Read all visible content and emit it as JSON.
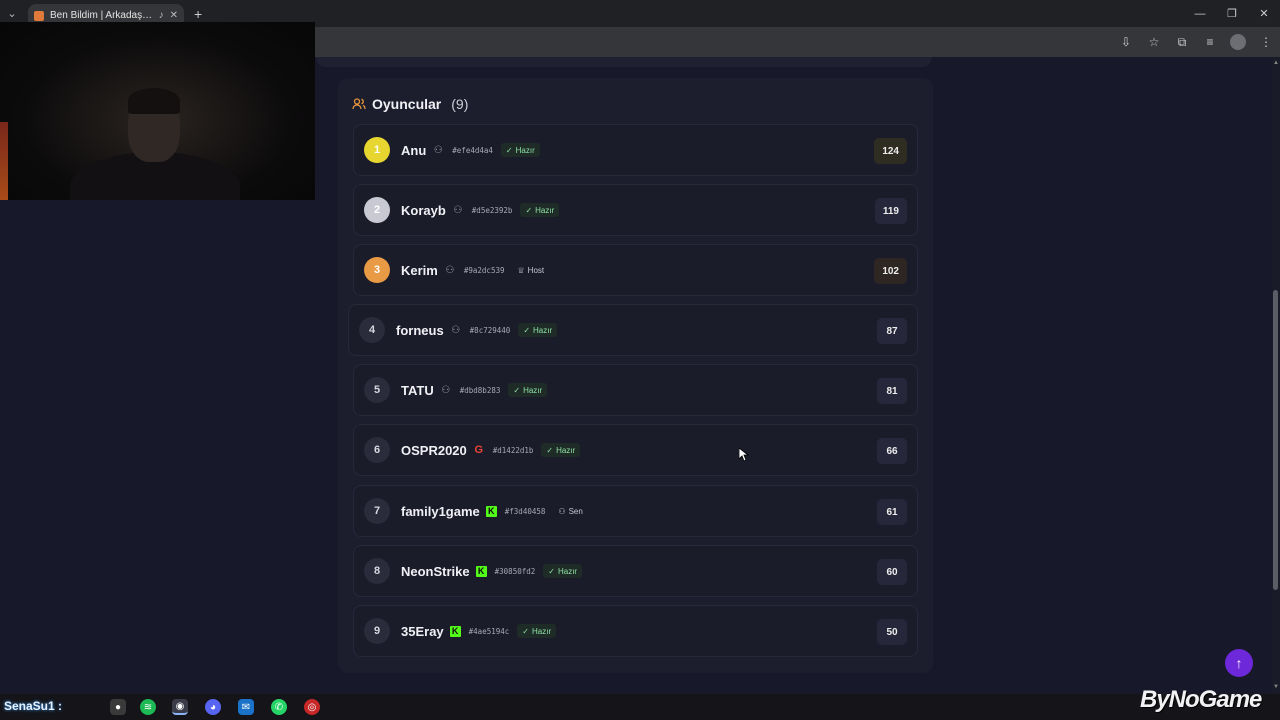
{
  "browser": {
    "tab_title": "Ben Bildim | Arkadaşlarınla",
    "new_tab": "+",
    "window_controls": [
      "—",
      "❐",
      "✕"
    ]
  },
  "panel": {
    "title": "Oyuncular",
    "count": "(9)"
  },
  "players": [
    {
      "rank": "1",
      "name": "Anu",
      "type": "user-icon",
      "id": "#efe4d4a4",
      "status": "Hazır",
      "status_type": "ready",
      "score": "124"
    },
    {
      "rank": "2",
      "name": "Korayb",
      "type": "user-icon",
      "id": "#d5e2392b",
      "status": "Hazır",
      "status_type": "ready",
      "score": "119"
    },
    {
      "rank": "3",
      "name": "Kerim",
      "type": "user-icon",
      "id": "#9a2dc539",
      "status": "Host",
      "status_type": "host",
      "score": "102"
    },
    {
      "rank": "4",
      "name": "forneus",
      "type": "user-icon",
      "id": "#8c729440",
      "status": "Hazır",
      "status_type": "ready",
      "score": "87"
    },
    {
      "rank": "5",
      "name": "TATU",
      "type": "user-icon",
      "id": "#dbd8b283",
      "status": "Hazır",
      "status_type": "ready",
      "score": "81"
    },
    {
      "rank": "6",
      "name": "OSPR2020",
      "type": "google-icon",
      "id": "#d1422d1b",
      "status": "Hazır",
      "status_type": "ready",
      "score": "66"
    },
    {
      "rank": "7",
      "name": "family1game",
      "type": "kick-icon",
      "id": "#f3d40458",
      "status": "Sen",
      "status_type": "you",
      "score": "61"
    },
    {
      "rank": "8",
      "name": "NeonStrike",
      "type": "kick-icon",
      "id": "#30850fd2",
      "status": "Hazır",
      "status_type": "ready",
      "score": "60"
    },
    {
      "rank": "9",
      "name": "35Eray",
      "type": "kick-icon",
      "id": "#4ae5194c",
      "status": "Hazır",
      "status_type": "ready",
      "score": "50"
    }
  ],
  "taskbar": {
    "overlay_text": "SenaSu1 :"
  },
  "watermark": "ByNoGame",
  "colors": {
    "background": "#17182a",
    "panel": "#1c1d2d",
    "accent_purple": "#6d28d9",
    "ready_green": "#8ee0a2",
    "gold": "#e7d62f",
    "silver": "#c9c9d3",
    "bronze": "#e99a44",
    "users_icon_orange": "#e9973a"
  }
}
